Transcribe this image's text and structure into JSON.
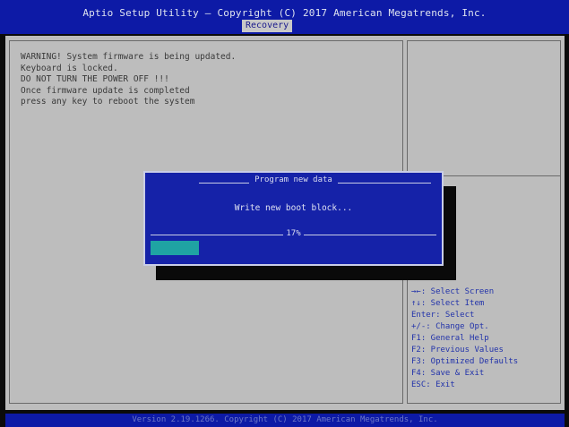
{
  "header": {
    "title": "Aptio Setup Utility – Copyright (C) 2017 American Megatrends, Inc.",
    "active_tab": "Recovery"
  },
  "message_lines": [
    "WARNING! System firmware is being updated.",
    "Keyboard is locked.",
    "DO NOT TURN THE POWER OFF !!!",
    "Once firmware update is completed",
    "press any key to reboot the system"
  ],
  "dialog": {
    "title": "Program new data",
    "text": "Write new boot block...",
    "percent_label": "17%",
    "progress": 0.17
  },
  "help_lines": [
    "→←: Select Screen",
    "↑↓: Select Item",
    "Enter: Select",
    "+/-: Change Opt.",
    "F1: General Help",
    "F2: Previous Values",
    "F3: Optimized Defaults",
    "F4: Save & Exit",
    "ESC: Exit"
  ],
  "footer": {
    "text": "Version 2.19.1266. Copyright (C) 2017 American Megatrends, Inc."
  },
  "colors": {
    "header_bg": "#0d1aa6",
    "panel_bg": "#bdbdbd",
    "dialog_bg": "#1522a8",
    "progress_fill": "#1fa3a3",
    "help_text": "#2233aa"
  }
}
